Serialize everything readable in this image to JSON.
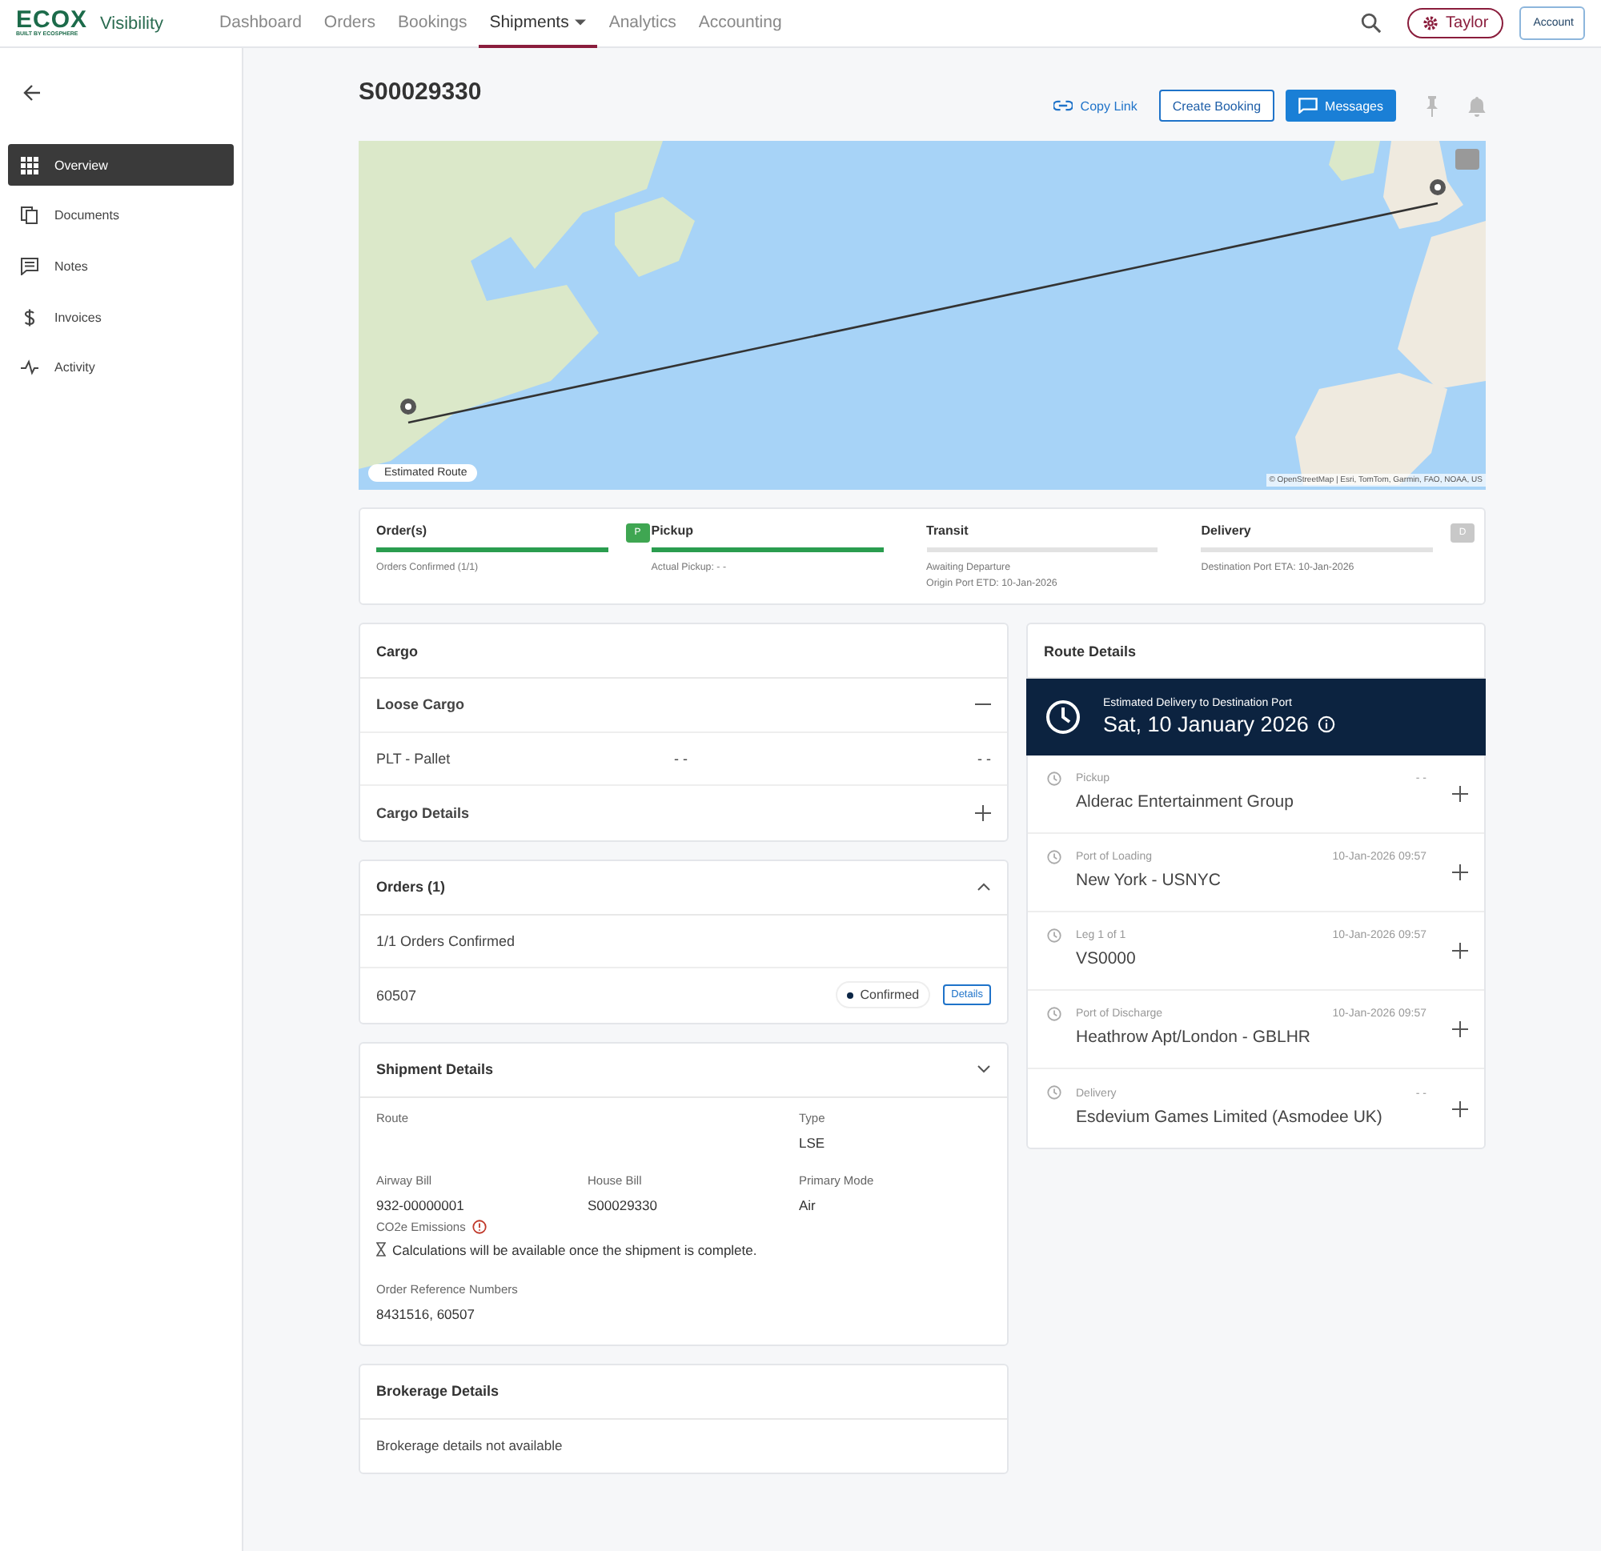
{
  "nav": {
    "logo": "ECOX",
    "logo_tagline": "BUILT BY ECOSPHERE",
    "product": "Visibility",
    "tabs": [
      {
        "label": "Dashboard",
        "selected": false,
        "dropdown": false
      },
      {
        "label": "Orders",
        "selected": false,
        "dropdown": false
      },
      {
        "label": "Bookings",
        "selected": false,
        "dropdown": false
      },
      {
        "label": "Shipments",
        "selected": true,
        "dropdown": true
      },
      {
        "label": "Analytics",
        "selected": false,
        "dropdown": false
      },
      {
        "label": "Accounting",
        "selected": false,
        "dropdown": false
      }
    ],
    "user": "Taylor",
    "account": "Account"
  },
  "sidebar": {
    "items": [
      {
        "label": "Overview",
        "selected": true
      },
      {
        "label": "Documents",
        "selected": false
      },
      {
        "label": "Notes",
        "selected": false
      },
      {
        "label": "Invoices",
        "selected": false
      },
      {
        "label": "Activity",
        "selected": false
      }
    ]
  },
  "shipment": {
    "title": "S00029330",
    "actions": [
      {
        "label": "Copy Link",
        "kind": "link"
      },
      {
        "label": "Create Booking",
        "kind": "outline"
      },
      {
        "label": "Messages",
        "kind": "primary"
      }
    ]
  },
  "map": {
    "legend": "Estimated Route",
    "attribution": "© OpenStreetMap | Esri, TomTom, Garmin, FAO, NOAA, US"
  },
  "progress": {
    "stages": [
      {
        "label": "Order(s)",
        "level": 1,
        "notes": [
          "Orders Confirmed (1/1)"
        ],
        "marker": {
          "label": "P",
          "active": true
        }
      },
      {
        "label": "Pickup",
        "level": 1,
        "notes": [
          "Actual Pickup: - -"
        ]
      },
      {
        "label": "Transit",
        "level": 0,
        "notes": [
          "Awaiting Departure",
          "Origin Port ETD: 10-Jan-2026"
        ]
      },
      {
        "label": "Delivery",
        "level": 0,
        "notes": [
          "Destination Port ETA: 10-Jan-2026"
        ],
        "marker": {
          "label": "D",
          "active": false
        }
      }
    ]
  },
  "cargo": {
    "title": "Cargo",
    "rows": [
      {
        "kind": "section",
        "label": "Loose Cargo",
        "expanded": true
      },
      {
        "kind": "line",
        "cells": [
          "PLT - Pallet",
          "- -",
          "- -"
        ]
      },
      {
        "kind": "section",
        "label": "Cargo Details",
        "expanded": false
      }
    ]
  },
  "orders": {
    "title": "Orders (1)",
    "expanded": true,
    "summary": "1/1 Orders Confirmed",
    "items": [
      {
        "number": "60507",
        "status": "Confirmed",
        "action": "Details"
      }
    ]
  },
  "shipment_details": {
    "title": "Shipment Details",
    "expanded": false,
    "fields": [
      {
        "label": "Route"
      },
      {
        "label": "Type",
        "value": "LSE"
      },
      {
        "label": "Airway Bill",
        "value": "932-00000001"
      },
      {
        "label": "House Bill",
        "value": "S00029330"
      },
      {
        "label": "Primary Mode",
        "value": "Air"
      }
    ],
    "emissions_label": "CO2e Emissions",
    "emissions_note": "Calculations will be available once the shipment is complete.",
    "reference_label": "Order Reference Numbers",
    "reference_value": "8431516, 60507"
  },
  "brokerage": {
    "title": "Brokerage Details",
    "message": "Brokerage details not available"
  },
  "route": {
    "title": "Route Details",
    "eta_label": "Estimated Delivery to Destination Port",
    "eta_date": "Sat, 10 January 2026",
    "stops": [
      {
        "label": "Pickup",
        "time": "- -",
        "name": "Alderac Entertainment Group"
      },
      {
        "label": "Port of Loading",
        "time": "10-Jan-2026 09:57",
        "name": "New York - USNYC"
      },
      {
        "label": "Leg 1 of 1",
        "time": "10-Jan-2026 09:57",
        "name": "VS0000"
      },
      {
        "label": "Port of Discharge",
        "time": "10-Jan-2026 09:57",
        "name": "Heathrow Apt/London - GBLHR"
      },
      {
        "label": "Delivery",
        "time": "- -",
        "name": "Esdevium Games Limited (Asmodee UK)"
      }
    ]
  }
}
